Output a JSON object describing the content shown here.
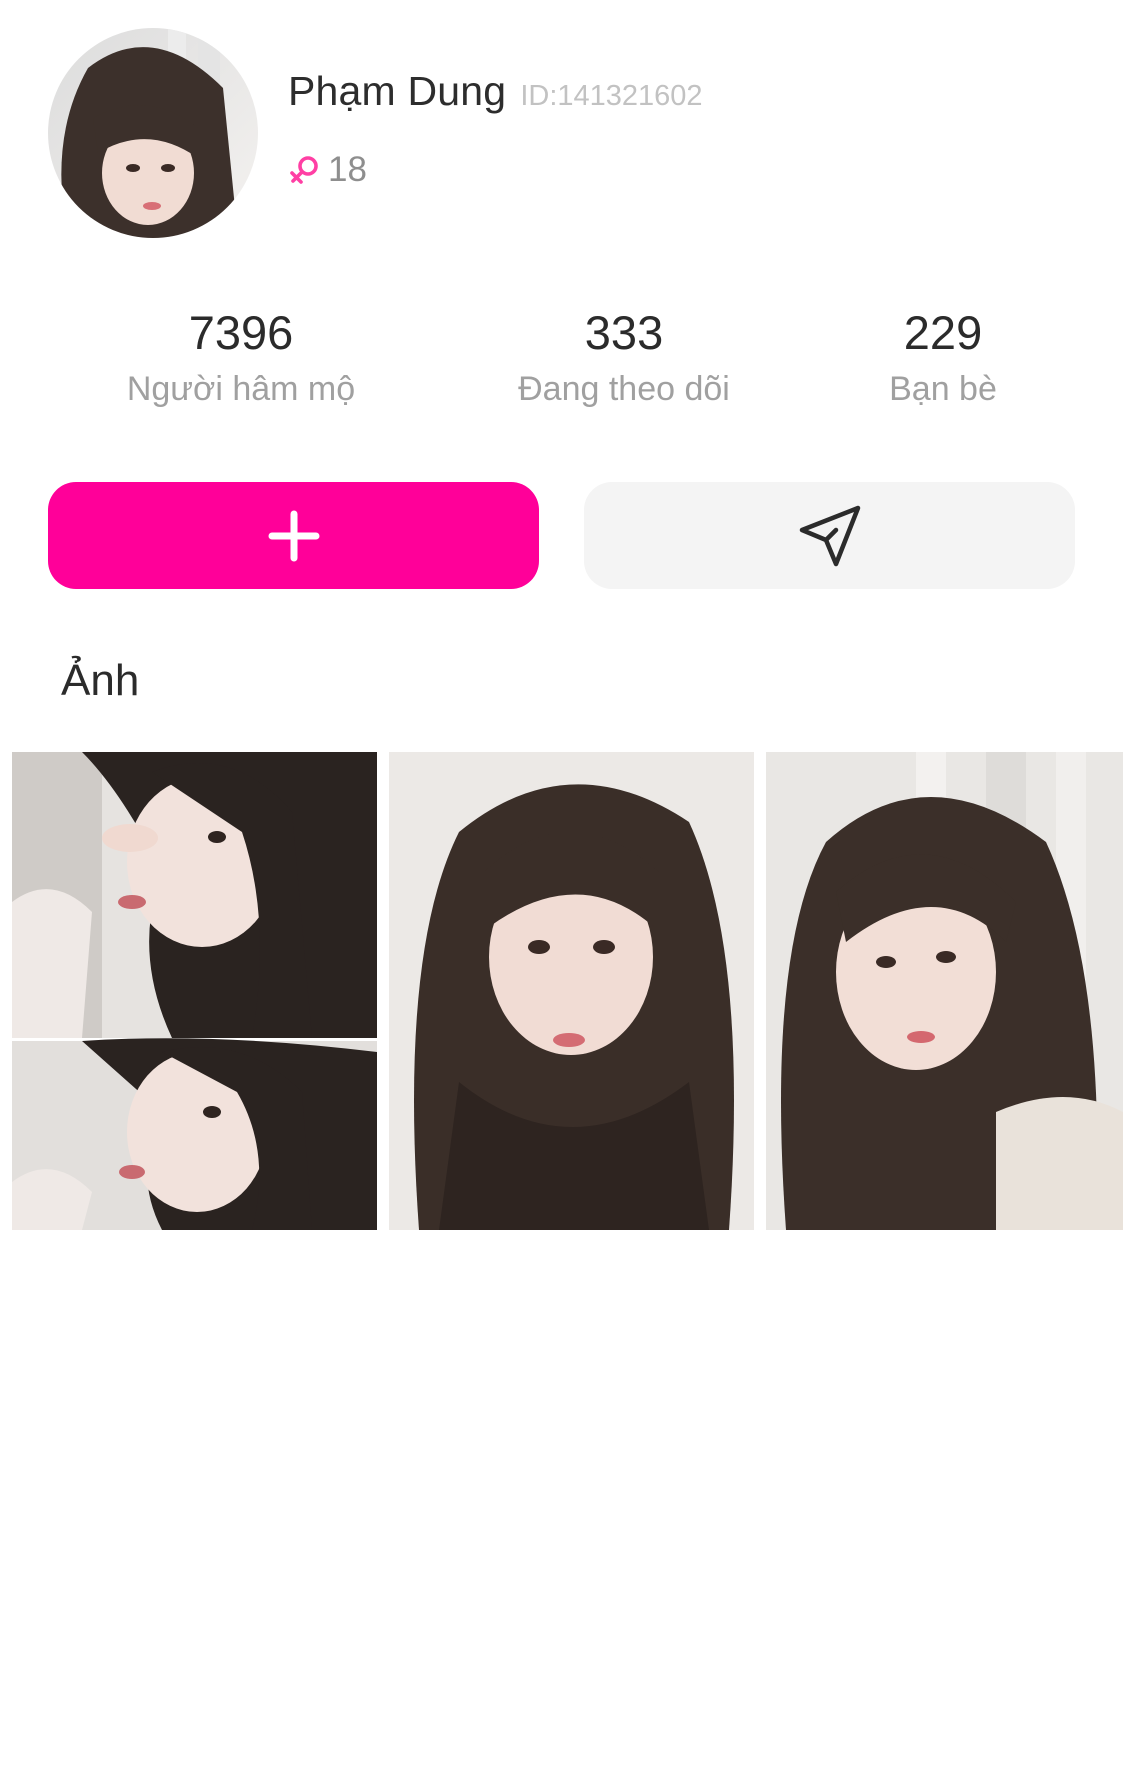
{
  "profile": {
    "name": "Phạm Dung",
    "id_text": "ID:141321602",
    "age": "18",
    "gender_icon": "female-icon",
    "accent_color": "#ff0099"
  },
  "stats": [
    {
      "value": "7396",
      "label": "Người hâm mộ"
    },
    {
      "value": "333",
      "label": "Đang theo dõi"
    },
    {
      "value": "229",
      "label": "Bạn bè"
    }
  ],
  "actions": {
    "follow_icon": "plus-icon",
    "message_icon": "send-icon"
  },
  "photos_section": {
    "title": "Ảnh"
  }
}
